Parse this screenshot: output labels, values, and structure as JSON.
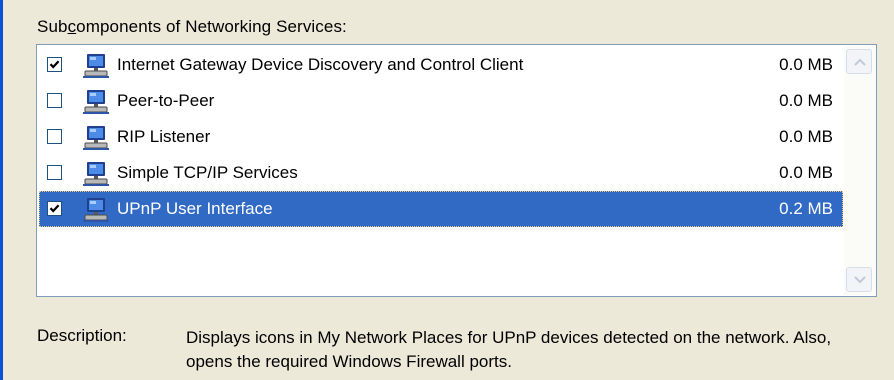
{
  "group": {
    "label_prefix": "Sub",
    "label_accel": "c",
    "label_suffix": "omponents of Networking Services:"
  },
  "components": [
    {
      "label": "Internet Gateway Device Discovery and Control Client",
      "size": "0.0 MB",
      "checked": true,
      "selected": false,
      "icon": "computer-network-icon"
    },
    {
      "label": "Peer-to-Peer",
      "size": "0.0 MB",
      "checked": false,
      "selected": false,
      "icon": "computer-network-icon"
    },
    {
      "label": "RIP Listener",
      "size": "0.0 MB",
      "checked": false,
      "selected": false,
      "icon": "computer-network-icon"
    },
    {
      "label": "Simple TCP/IP Services",
      "size": "0.0 MB",
      "checked": false,
      "selected": false,
      "icon": "computer-network-icon"
    },
    {
      "label": "UPnP User Interface",
      "size": "0.2 MB",
      "checked": true,
      "selected": true,
      "icon": "computer-network-icon"
    }
  ],
  "description": {
    "label": "Description:",
    "text": "Displays icons in My Network Places for UPnP devices detected on the network. Also, opens the required Windows Firewall ports."
  },
  "colors": {
    "selection": "#316AC5",
    "dialog_bg": "#ECE9D8",
    "list_border": "#7F9DB9"
  }
}
